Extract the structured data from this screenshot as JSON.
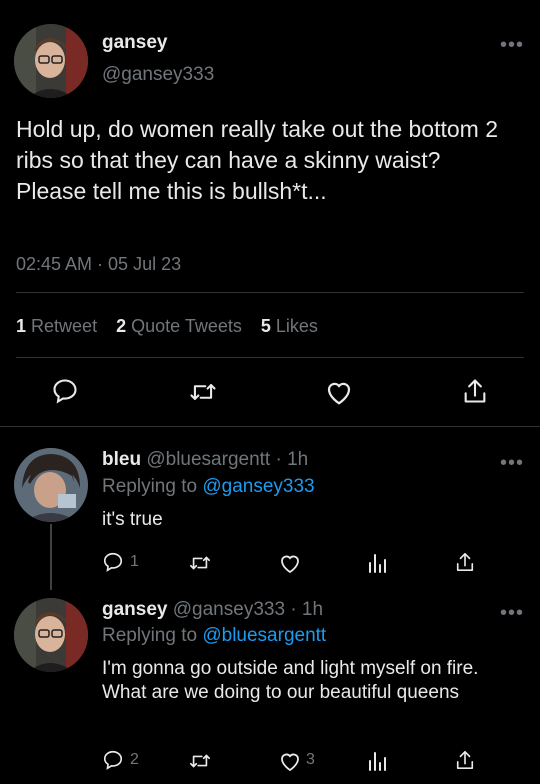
{
  "main_tweet": {
    "name": "gansey",
    "handle": "@gansey333",
    "text": "Hold up, do women really take out the bottom 2 ribs so that they can have a skinny waist? Please tell me this is bullsh*t...",
    "timestamp": "02:45 AM · 05 Jul 23",
    "stats": {
      "retweets_num": "1",
      "retweets_label": "Retweet",
      "quotes_num": "2",
      "quotes_label": "Quote Tweets",
      "likes_num": "5",
      "likes_label": "Likes"
    }
  },
  "replies": [
    {
      "name": "bleu",
      "handle": "@bluesargentt",
      "time": "· 1h",
      "replying_prefix": "Replying to",
      "replying_to": "@gansey333",
      "text": "it's true",
      "reply_count": "1",
      "like_count": ""
    },
    {
      "name": "gansey",
      "handle": "@gansey333",
      "time": "· 1h",
      "replying_prefix": "Replying to",
      "replying_to": "@bluesargentt",
      "text": "I'm gonna go outside and light myself on fire. What are we doing to our beautiful queens",
      "reply_count": "2",
      "like_count": "3"
    }
  ],
  "colors": {
    "background": "#000000",
    "text": "#e7e9ea",
    "muted": "#71767b",
    "link": "#1d9bf0",
    "divider": "#2f3336"
  }
}
